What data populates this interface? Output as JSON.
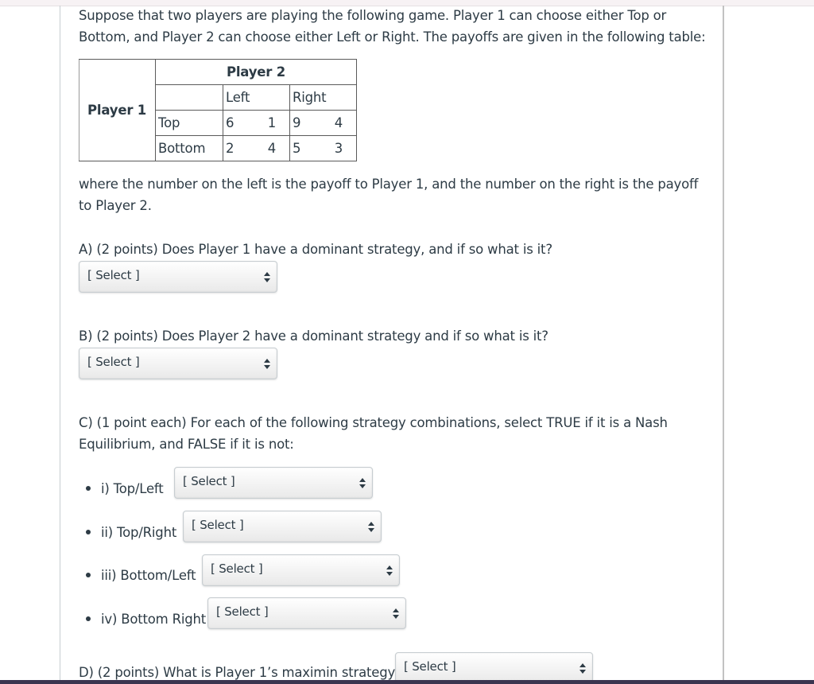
{
  "intro": "Suppose that two players are playing the following game.  Player 1 can choose either Top or Bottom, and Player 2 can choose either Left or Right.  The payoffs are given in the following table:",
  "table": {
    "row_player": "Player 1",
    "col_player": "Player 2",
    "col_headers": [
      "Left",
      "Right"
    ],
    "rows": [
      {
        "label": "Top",
        "cells": [
          [
            "6",
            "1"
          ],
          [
            "9",
            "4"
          ]
        ]
      },
      {
        "label": "Bottom",
        "cells": [
          [
            "2",
            "4"
          ],
          [
            "5",
            "3"
          ]
        ]
      }
    ]
  },
  "explanation": "where the number on the left is the payoff to Player 1, and the number on the right is the payoff to Player 2.",
  "questions": {
    "a": {
      "text": "A) (2 points) Does Player 1 have a dominant strategy, and if so what is it?",
      "select": "[ Select ]"
    },
    "b": {
      "text": "B) (2 points) Does Player 2 have a dominant strategy and if so what is it?",
      "select": "[ Select ]"
    },
    "c": {
      "text": "C) (1 point each) For each of the following strategy combinations, select TRUE if it is a Nash Equilibrium, and FALSE if it is not:",
      "items": [
        {
          "label": "i)  Top/Left",
          "select": "[ Select ]"
        },
        {
          "label": "ii) Top/Right",
          "select": "[ Select ]"
        },
        {
          "label": "iii) Bottom/Left",
          "select": "[ Select ]"
        },
        {
          "label": "iv) Bottom Right",
          "select": "[ Select ]"
        }
      ]
    },
    "d": {
      "text": "D) (2 points) What is Player 1’s maximin strategy?",
      "select": "[ Select ]"
    }
  }
}
